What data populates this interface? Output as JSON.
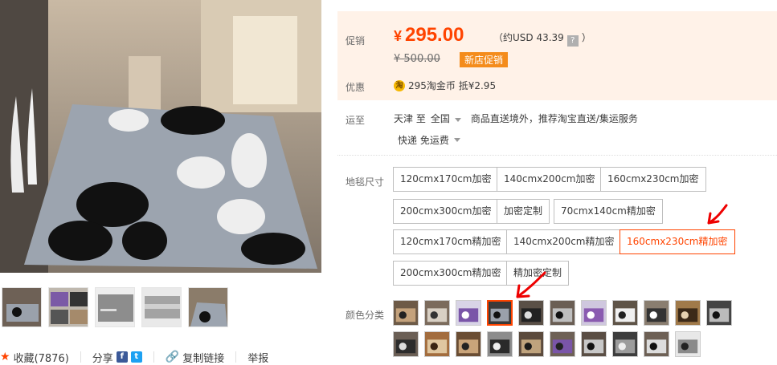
{
  "price": {
    "label_promo": "促销",
    "currency": "¥",
    "current": "295.00",
    "approx_prefix": "（约USD 43.39",
    "approx_help": "?",
    "approx_suffix": "）",
    "old_price": "¥ 500.00",
    "badge": "新店促销",
    "label_discount": "优惠",
    "coin_icon": "淘",
    "coin_text": "295淘金币 抵¥2.95"
  },
  "shipping": {
    "label": "运至",
    "from": "天津 至",
    "to": "全国",
    "service": "商品直送境外，推荐淘宝直送/集运服务",
    "method": "快递 免运费"
  },
  "sizes": {
    "label": "地毯尺寸",
    "options": [
      "120cmx170cm加密",
      "140cmx200cm加密",
      "160cmx230cm加密",
      "200cmx300cm加密",
      "加密定制",
      "70cmx140cm精加密",
      "120cmx170cm精加密",
      "140cmx200cm精加密",
      "160cmx230cm精加密",
      "200cmx300cm精加密",
      "精加密定制"
    ],
    "selected_index": 8
  },
  "colors": {
    "label": "颜色分类",
    "selected_index": 3,
    "count": 21
  },
  "actions": {
    "favorite": "收藏(7876)",
    "share": "分享",
    "facebook_icon": "f",
    "twitter_icon": "t",
    "copy_link": "复制链接",
    "report": "举报"
  },
  "theme": {
    "accent": "#ff4400",
    "promo_bg": "#fff2e8",
    "badge_bg": "#f48c1c"
  }
}
